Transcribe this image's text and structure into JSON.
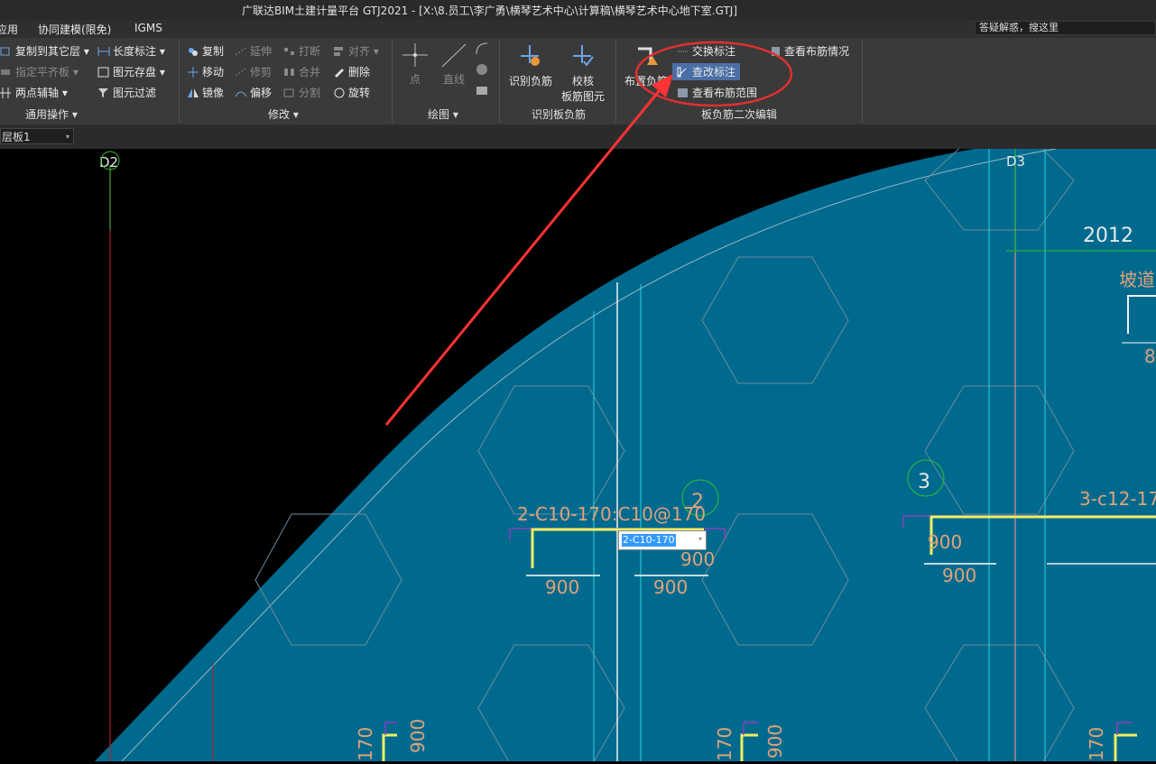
{
  "titlebar": {
    "title": "广联达BIM土建计量平台 GTJ2021 - [X:\\8.员工\\李广勇\\横琴艺术中心\\计算稿\\横琴艺术中心地下室.GTJ]"
  },
  "menubar": {
    "items": [
      "应用",
      "协同建模(限免)",
      "IGMS"
    ],
    "search_placeholder": "答疑解惑，搜这里"
  },
  "ribbon": {
    "common": {
      "copy_to_layer": "复制到其它层",
      "assign_slab": "指定平齐板",
      "two_point_axis": "两点辅轴",
      "length_dim": "长度标注",
      "save_elements": "图元存盘",
      "element_filter": "图元过滤",
      "group_label": "通用操作"
    },
    "modify": {
      "copy": "复制",
      "extend": "延伸",
      "break": "打断",
      "align": "对齐",
      "move": "移动",
      "trim": "修剪",
      "merge": "合并",
      "delete": "删除",
      "mirror": "镜像",
      "offset": "偏移",
      "split": "分割",
      "rotate": "旋转",
      "group_label": "修改"
    },
    "draw": {
      "point": "点",
      "line": "直线",
      "group_label": "绘图"
    },
    "identify": {
      "identify_neg": "识别负筋",
      "check_line1": "校核",
      "check_line2": "板筋图元",
      "group_label": "识别板负筋"
    },
    "edit2": {
      "place_neg": "布置负筋",
      "swap_label": "交换标注",
      "check_label": "查改标注",
      "view_range": "查看布筋范围",
      "view_layout": "查看布筋情况",
      "group_label": "板负筋二次编辑"
    }
  },
  "layer": {
    "selected": "层板1"
  },
  "drawing": {
    "axis_left": "D2",
    "axis_right": "D3",
    "dim_2012": "2012",
    "ramp_label": "坡道",
    "ramp_dim": "8",
    "rebar2_label": "2-C10-170:C10@170",
    "rebar2_num": "2",
    "rebar3_label": "3-c12-17",
    "rebar3_num": "3",
    "dim_900": "900",
    "dim_170": "170"
  },
  "editbox": {
    "value": "2-C10-170"
  },
  "colors": {
    "slab": "#006a8e",
    "annotation": "#e0a37a",
    "callout": "#e03030",
    "arrow": "#ff3333"
  }
}
